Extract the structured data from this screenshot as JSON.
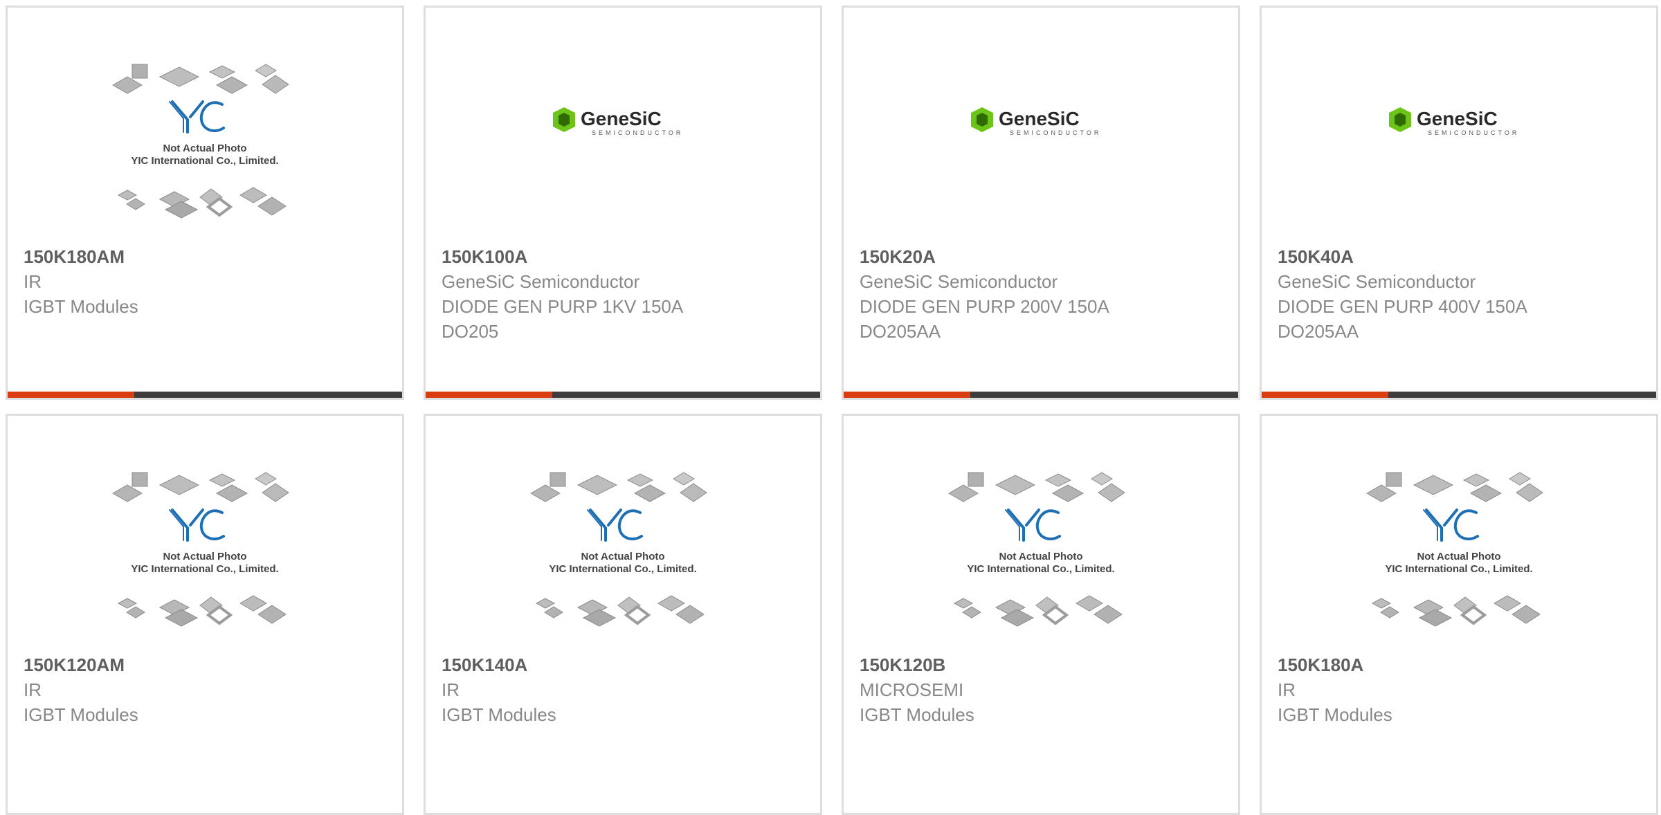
{
  "products": [
    {
      "part": "150K180AM",
      "manufacturer": "IR",
      "description": [
        "IGBT Modules"
      ],
      "image": "yic-placeholder"
    },
    {
      "part": "150K100A",
      "manufacturer": "GeneSiC Semiconductor",
      "description": [
        "DIODE GEN PURP 1KV 150A",
        "DO205"
      ],
      "image": "genesic-logo"
    },
    {
      "part": "150K20A",
      "manufacturer": "GeneSiC Semiconductor",
      "description": [
        "DIODE GEN PURP 200V 150A",
        "DO205AA"
      ],
      "image": "genesic-logo"
    },
    {
      "part": "150K40A",
      "manufacturer": "GeneSiC Semiconductor",
      "description": [
        "DIODE GEN PURP 400V 150A",
        "DO205AA"
      ],
      "image": "genesic-logo"
    },
    {
      "part": "150K120AM",
      "manufacturer": "IR",
      "description": [
        "IGBT Modules"
      ],
      "image": "yic-placeholder"
    },
    {
      "part": "150K140A",
      "manufacturer": "IR",
      "description": [
        "IGBT Modules"
      ],
      "image": "yic-placeholder"
    },
    {
      "part": "150K120B",
      "manufacturer": "MICROSEMI",
      "description": [
        "IGBT Modules"
      ],
      "image": "yic-placeholder"
    },
    {
      "part": "150K180A",
      "manufacturer": "IR",
      "description": [
        "IGBT Modules"
      ],
      "image": "yic-placeholder"
    }
  ],
  "placeholder": {
    "logo_text": "YIC",
    "line1": "Not Actual Photo",
    "line2": "YIC International Co., Limited."
  },
  "genesic_logo": {
    "name": "GeneSiC",
    "tagline": "SEMICONDUCTOR"
  },
  "colors": {
    "accent_bar": "#d93d10",
    "dark_bar": "#3d3d3d",
    "card_border": "#dedede",
    "genesic_green": "#6cc417",
    "yic_blue": "#1f6fb5"
  }
}
